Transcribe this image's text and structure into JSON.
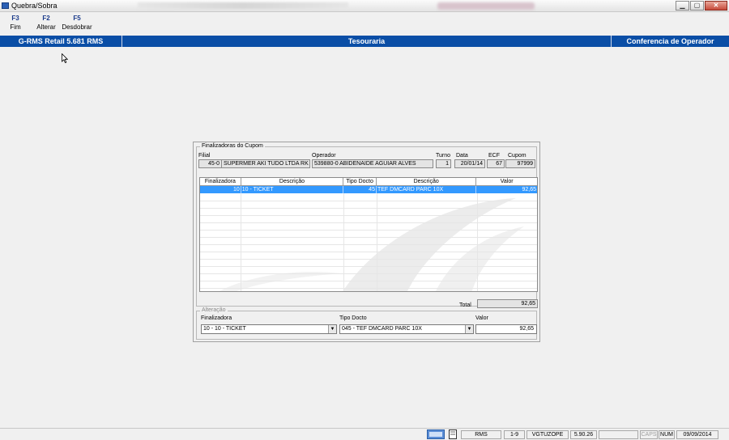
{
  "window": {
    "title": "Quebra/Sobra",
    "min_glyph": "▁",
    "max_glyph": "▢",
    "close_glyph": "✕"
  },
  "fkeys": [
    {
      "key": "F3",
      "label": "Fim"
    },
    {
      "key": "F2",
      "label": "Alterar"
    },
    {
      "key": "F5",
      "label": "Desdobrar"
    }
  ],
  "header": {
    "left": "G-RMS Retail 5.681 RMS",
    "center": "Tesouraria",
    "right": "Conferencia de Operador"
  },
  "dialog": {
    "group_title": "Finalizadoras do Cupom",
    "fields": {
      "filial_label": "Filial",
      "filial_code": "45-0",
      "filial_name": "SUPERMER AKI TUDO LTDA RK",
      "operador_label": "Operador",
      "operador_value": "539880-0 ABIDENAIDE AGUIAR ALVES",
      "turno_label": "Turno",
      "turno_value": "1",
      "data_label": "Data",
      "data_value": "20/01/14",
      "ecf_label": "ECF",
      "ecf_value": "67",
      "cupom_label": "Cupom",
      "cupom_value": "97999"
    },
    "grid": {
      "columns": [
        "Finalizadora",
        "Descrição",
        "Tipo Docto",
        "Descrição",
        "Valor"
      ],
      "rows": [
        {
          "finalizadora": "10",
          "descricao": "10 - TICKET",
          "tipo_docto": "45",
          "descricao2": "TEF DMCARD PARC 10X",
          "valor": "92,65"
        }
      ]
    },
    "total_label": "Total",
    "total_value": "92,65",
    "alteracao": {
      "title": "Alteração",
      "finalizadora_label": "Finalizadora",
      "finalizadora_value": "10 - 10 - TICKET",
      "tipo_docto_label": "Tipo Docto",
      "tipo_docto_value": "045 - TEF DMCARD PARC 10X",
      "valor_label": "Valor",
      "valor_value": "92,65"
    }
  },
  "statusbar": {
    "rms": "RMS",
    "range": "1-9",
    "user": "VGTUZOPE",
    "version": "5.90.26",
    "caps": "CAPS",
    "num": "NUM",
    "date": "09/09/2014"
  },
  "colors": {
    "header_blue": "#0a4ea6",
    "selection": "#3399ff"
  }
}
